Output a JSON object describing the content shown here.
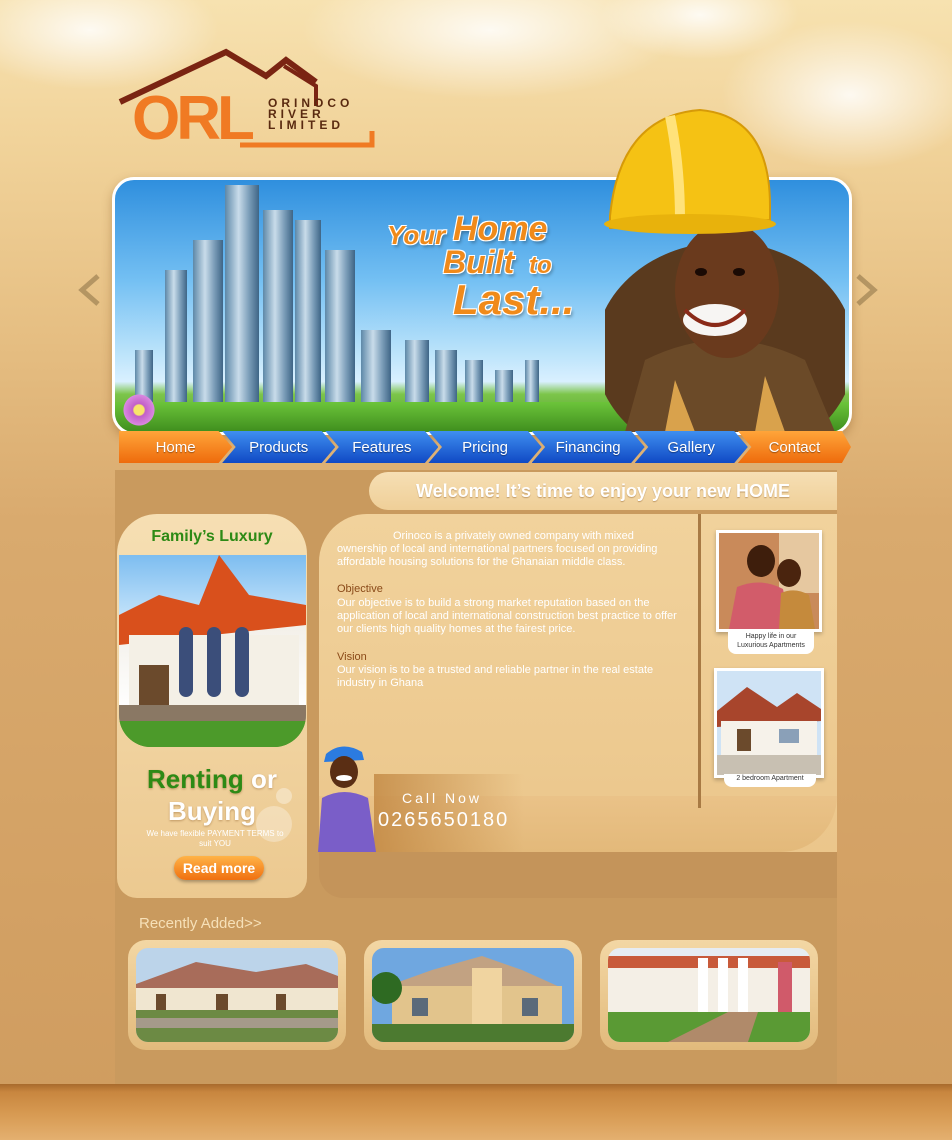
{
  "logo": {
    "initials": "ORL",
    "line1": "Orinoco",
    "line2": "River",
    "line3": "Limited"
  },
  "banner": {
    "tagline_your": "Your",
    "tagline_home": "Home",
    "tagline_built": "Built",
    "tagline_to": "to",
    "tagline_last": "Last...",
    "prev_icon": "chevron-left-icon",
    "next_icon": "chevron-right-icon"
  },
  "nav": [
    {
      "label": "Home"
    },
    {
      "label": "Products"
    },
    {
      "label": "Features"
    },
    {
      "label": "Pricing"
    },
    {
      "label": "Financing"
    },
    {
      "label": "Gallery"
    },
    {
      "label": "Contact"
    }
  ],
  "welcome": "Welcome! It’s time to enjoy your new HOME",
  "sidebar": {
    "title": "Family’s Luxury",
    "renting": "Renting",
    "or": "or",
    "buying": "Buying",
    "terms": "We have flexible PAYMENT TERMS to suit YOU",
    "read_more": "Read more"
  },
  "content": {
    "intro": "Orinoco is a privately owned company with mixed ownership of local and international partners focused on providing affordable housing solutions for the Ghanaian middle class.",
    "objective_label": "Objective",
    "objective_text": "Our objective is to build a strong market reputation based on the application of local and international construction best practice to offer our clients high quality homes at the fairest price.",
    "vision_label": "Vision",
    "vision_text": "Our vision is to be a trusted and reliable partner in the real estate industry in Ghana"
  },
  "call": {
    "label": "Call Now",
    "phone": "0265650180"
  },
  "thumbs": [
    {
      "caption": "Happy life in our Luxurious Apartments"
    },
    {
      "caption": "2 bedroom Apartment"
    }
  ],
  "recent": {
    "title": "Recently Added>>"
  },
  "colors": {
    "accent_orange": "#f07a23",
    "nav_blue": "#1a5fd8",
    "green_title": "#2d8a15",
    "brown": "#c99a5e"
  }
}
